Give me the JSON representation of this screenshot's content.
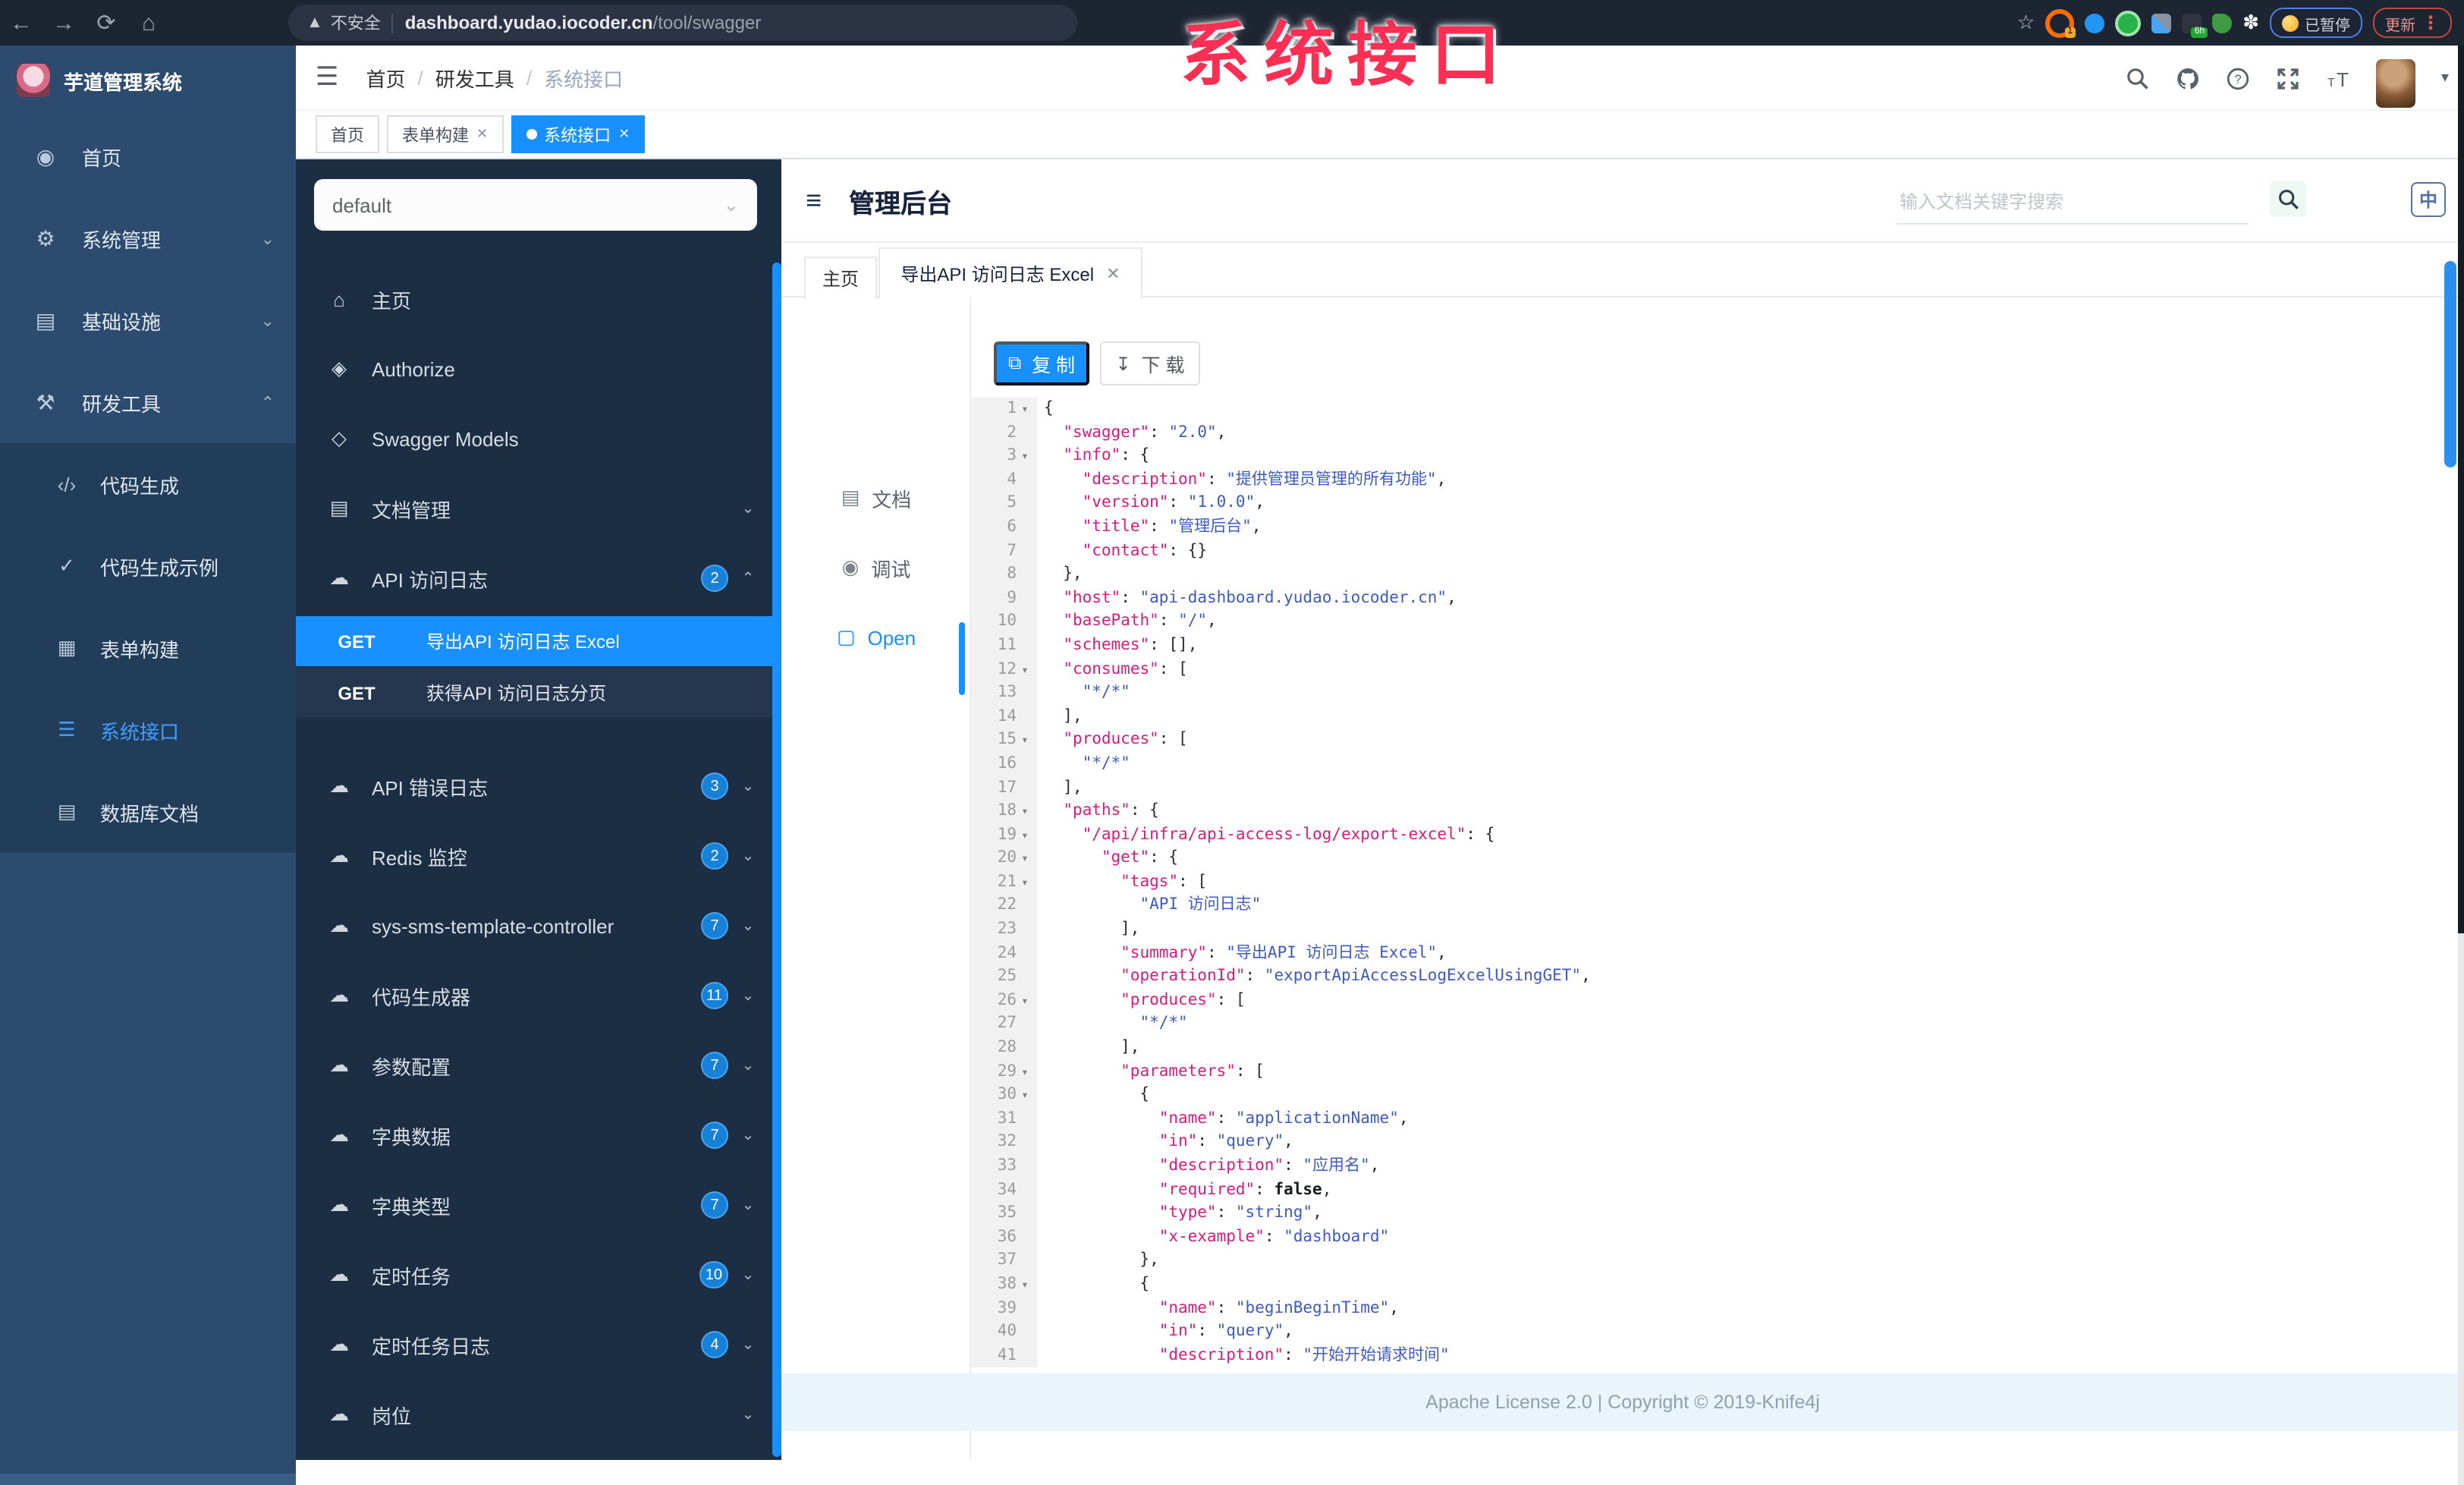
{
  "overlay": {
    "text": "系统接口",
    "color": "#fb2e53"
  },
  "browser": {
    "security_label": "不安全",
    "url_host": "dashboard.yudao.iocoder.cn",
    "url_path": "/tool/swagger",
    "ext_badge_orange": "1",
    "ext_badge_time": "6h",
    "paused_label": "已暂停",
    "update_label": "更新"
  },
  "app": {
    "logo_title": "芋道管理系统",
    "breadcrumb": [
      "首页",
      "研发工具",
      "系统接口"
    ],
    "tags": [
      {
        "label": "首页",
        "active": false,
        "closable": false
      },
      {
        "label": "表单构建",
        "active": false,
        "closable": true
      },
      {
        "label": "系统接口",
        "active": true,
        "closable": true
      }
    ],
    "sidebar_items": [
      {
        "icon": "gauge-icon",
        "label": "首页",
        "chevron": ""
      },
      {
        "icon": "gear-icon",
        "label": "系统管理",
        "chevron": "down"
      },
      {
        "icon": "monitor-icon",
        "label": "基础设施",
        "chevron": "down"
      },
      {
        "icon": "toolbox-icon",
        "label": "研发工具",
        "chevron": "up"
      }
    ],
    "sidebar_submenu": [
      {
        "icon": "code-icon",
        "label": "代码生成",
        "active": false
      },
      {
        "icon": "shield-check-icon",
        "label": "代码生成示例",
        "active": false
      },
      {
        "icon": "grid-icon",
        "label": "表单构建",
        "active": false
      },
      {
        "icon": "list-icon",
        "label": "系统接口",
        "active": true
      },
      {
        "icon": "table-icon",
        "label": "数据库文档",
        "active": false
      }
    ]
  },
  "kpanel": {
    "group_value": "default",
    "menu": [
      {
        "icon": "home-icon",
        "label": "主页",
        "badge": "",
        "chevron": ""
      },
      {
        "icon": "lock-icon",
        "label": "Authorize",
        "badge": "",
        "chevron": ""
      },
      {
        "icon": "models-icon",
        "label": "Swagger Models",
        "badge": "",
        "chevron": ""
      },
      {
        "icon": "doc-icon",
        "label": "文档管理",
        "badge": "",
        "chevron": "down"
      },
      {
        "icon": "cloud-icon",
        "label": "API 访问日志",
        "badge": "2",
        "chevron": "up",
        "children": [
          {
            "method": "GET",
            "name": "导出API 访问日志 Excel",
            "active": true
          },
          {
            "method": "GET",
            "name": "获得API 访问日志分页",
            "active": false
          }
        ]
      },
      {
        "icon": "cloud-icon",
        "label": "API 错误日志",
        "badge": "3",
        "chevron": "down"
      },
      {
        "icon": "cloud-icon",
        "label": "Redis 监控",
        "badge": "2",
        "chevron": "down"
      },
      {
        "icon": "cloud-icon",
        "label": "sys-sms-template-controller",
        "badge": "7",
        "chevron": "down"
      },
      {
        "icon": "cloud-icon",
        "label": "代码生成器",
        "badge": "11",
        "chevron": "down"
      },
      {
        "icon": "cloud-icon",
        "label": "参数配置",
        "badge": "7",
        "chevron": "down"
      },
      {
        "icon": "cloud-icon",
        "label": "字典数据",
        "badge": "7",
        "chevron": "down"
      },
      {
        "icon": "cloud-icon",
        "label": "字典类型",
        "badge": "7",
        "chevron": "down"
      },
      {
        "icon": "cloud-icon",
        "label": "定时任务",
        "badge": "10",
        "chevron": "down"
      },
      {
        "icon": "cloud-icon",
        "label": "定时任务日志",
        "badge": "4",
        "chevron": "down"
      },
      {
        "icon": "cloud-icon",
        "label": "岗位",
        "badge": "",
        "chevron": "down"
      }
    ]
  },
  "doc": {
    "title": "管理后台",
    "search_placeholder": "输入文档关键字搜索",
    "lang_label": "中",
    "tabs": [
      {
        "label": "主页",
        "closable": false,
        "active": false
      },
      {
        "label": "导出API 访问日志 Excel",
        "closable": true,
        "active": true
      }
    ],
    "side_tabs": [
      {
        "icon": "document-icon",
        "label": "文档",
        "active": false
      },
      {
        "icon": "bug-icon",
        "label": "调试",
        "active": false
      },
      {
        "icon": "file-icon",
        "label": "Open",
        "active": true
      }
    ],
    "copy_label": "复 制",
    "download_label": "下 载",
    "footer": "Apache License 2.0 | Copyright © 2019-Knife4j"
  },
  "code": {
    "lines": [
      {
        "n": 1,
        "f": true,
        "s": [
          [
            "pun",
            "{"
          ]
        ]
      },
      {
        "n": 2,
        "f": false,
        "s": [
          [
            "pun",
            "  "
          ],
          [
            "key",
            "\"swagger\""
          ],
          [
            "pun",
            ": "
          ],
          [
            "str",
            "\"2.0\""
          ],
          [
            "pun",
            ","
          ]
        ]
      },
      {
        "n": 3,
        "f": true,
        "s": [
          [
            "pun",
            "  "
          ],
          [
            "key",
            "\"info\""
          ],
          [
            "pun",
            ": {"
          ]
        ]
      },
      {
        "n": 4,
        "f": false,
        "s": [
          [
            "pun",
            "    "
          ],
          [
            "key",
            "\"description\""
          ],
          [
            "pun",
            ": "
          ],
          [
            "str",
            "\"提供管理员管理的所有功能\""
          ],
          [
            "pun",
            ","
          ]
        ]
      },
      {
        "n": 5,
        "f": false,
        "s": [
          [
            "pun",
            "    "
          ],
          [
            "key",
            "\"version\""
          ],
          [
            "pun",
            ": "
          ],
          [
            "str",
            "\"1.0.0\""
          ],
          [
            "pun",
            ","
          ]
        ]
      },
      {
        "n": 6,
        "f": false,
        "s": [
          [
            "pun",
            "    "
          ],
          [
            "key",
            "\"title\""
          ],
          [
            "pun",
            ": "
          ],
          [
            "str",
            "\"管理后台\""
          ],
          [
            "pun",
            ","
          ]
        ]
      },
      {
        "n": 7,
        "f": false,
        "s": [
          [
            "pun",
            "    "
          ],
          [
            "key",
            "\"contact\""
          ],
          [
            "pun",
            ": {}"
          ]
        ]
      },
      {
        "n": 8,
        "f": false,
        "s": [
          [
            "pun",
            "  },"
          ]
        ]
      },
      {
        "n": 9,
        "f": false,
        "s": [
          [
            "pun",
            "  "
          ],
          [
            "key",
            "\"host\""
          ],
          [
            "pun",
            ": "
          ],
          [
            "str",
            "\"api-dashboard.yudao.iocoder.cn\""
          ],
          [
            "pun",
            ","
          ]
        ]
      },
      {
        "n": 10,
        "f": false,
        "s": [
          [
            "pun",
            "  "
          ],
          [
            "key",
            "\"basePath\""
          ],
          [
            "pun",
            ": "
          ],
          [
            "str",
            "\"/\""
          ],
          [
            "pun",
            ","
          ]
        ]
      },
      {
        "n": 11,
        "f": false,
        "s": [
          [
            "pun",
            "  "
          ],
          [
            "key",
            "\"schemes\""
          ],
          [
            "pun",
            ": [],"
          ]
        ]
      },
      {
        "n": 12,
        "f": true,
        "s": [
          [
            "pun",
            "  "
          ],
          [
            "key",
            "\"consumes\""
          ],
          [
            "pun",
            ": ["
          ]
        ]
      },
      {
        "n": 13,
        "f": false,
        "s": [
          [
            "pun",
            "    "
          ],
          [
            "str",
            "\"*/*\""
          ]
        ]
      },
      {
        "n": 14,
        "f": false,
        "s": [
          [
            "pun",
            "  ],"
          ]
        ]
      },
      {
        "n": 15,
        "f": true,
        "s": [
          [
            "pun",
            "  "
          ],
          [
            "key",
            "\"produces\""
          ],
          [
            "pun",
            ": ["
          ]
        ]
      },
      {
        "n": 16,
        "f": false,
        "s": [
          [
            "pun",
            "    "
          ],
          [
            "str",
            "\"*/*\""
          ]
        ]
      },
      {
        "n": 17,
        "f": false,
        "s": [
          [
            "pun",
            "  ],"
          ]
        ]
      },
      {
        "n": 18,
        "f": true,
        "s": [
          [
            "pun",
            "  "
          ],
          [
            "key",
            "\"paths\""
          ],
          [
            "pun",
            ": {"
          ]
        ]
      },
      {
        "n": 19,
        "f": true,
        "s": [
          [
            "pun",
            "    "
          ],
          [
            "key",
            "\"/api/infra/api-access-log/export-excel\""
          ],
          [
            "pun",
            ": {"
          ]
        ]
      },
      {
        "n": 20,
        "f": true,
        "s": [
          [
            "pun",
            "      "
          ],
          [
            "key",
            "\"get\""
          ],
          [
            "pun",
            ": {"
          ]
        ]
      },
      {
        "n": 21,
        "f": true,
        "s": [
          [
            "pun",
            "        "
          ],
          [
            "key",
            "\"tags\""
          ],
          [
            "pun",
            ": ["
          ]
        ]
      },
      {
        "n": 22,
        "f": false,
        "s": [
          [
            "pun",
            "          "
          ],
          [
            "str",
            "\"API 访问日志\""
          ]
        ]
      },
      {
        "n": 23,
        "f": false,
        "s": [
          [
            "pun",
            "        ],"
          ]
        ]
      },
      {
        "n": 24,
        "f": false,
        "s": [
          [
            "pun",
            "        "
          ],
          [
            "key",
            "\"summary\""
          ],
          [
            "pun",
            ": "
          ],
          [
            "str",
            "\"导出API 访问日志 Excel\""
          ],
          [
            "pun",
            ","
          ]
        ]
      },
      {
        "n": 25,
        "f": false,
        "s": [
          [
            "pun",
            "        "
          ],
          [
            "key",
            "\"operationId\""
          ],
          [
            "pun",
            ": "
          ],
          [
            "str",
            "\"exportApiAccessLogExcelUsingGET\""
          ],
          [
            "pun",
            ","
          ]
        ]
      },
      {
        "n": 26,
        "f": true,
        "s": [
          [
            "pun",
            "        "
          ],
          [
            "key",
            "\"produces\""
          ],
          [
            "pun",
            ": ["
          ]
        ]
      },
      {
        "n": 27,
        "f": false,
        "s": [
          [
            "pun",
            "          "
          ],
          [
            "str",
            "\"*/*\""
          ]
        ]
      },
      {
        "n": 28,
        "f": false,
        "s": [
          [
            "pun",
            "        ],"
          ]
        ]
      },
      {
        "n": 29,
        "f": true,
        "s": [
          [
            "pun",
            "        "
          ],
          [
            "key",
            "\"parameters\""
          ],
          [
            "pun",
            ": ["
          ]
        ]
      },
      {
        "n": 30,
        "f": true,
        "s": [
          [
            "pun",
            "          {"
          ]
        ]
      },
      {
        "n": 31,
        "f": false,
        "s": [
          [
            "pun",
            "            "
          ],
          [
            "key",
            "\"name\""
          ],
          [
            "pun",
            ": "
          ],
          [
            "str",
            "\"applicationName\""
          ],
          [
            "pun",
            ","
          ]
        ]
      },
      {
        "n": 32,
        "f": false,
        "s": [
          [
            "pun",
            "            "
          ],
          [
            "key",
            "\"in\""
          ],
          [
            "pun",
            ": "
          ],
          [
            "str",
            "\"query\""
          ],
          [
            "pun",
            ","
          ]
        ]
      },
      {
        "n": 33,
        "f": false,
        "s": [
          [
            "pun",
            "            "
          ],
          [
            "key",
            "\"description\""
          ],
          [
            "pun",
            ": "
          ],
          [
            "str",
            "\"应用名\""
          ],
          [
            "pun",
            ","
          ]
        ]
      },
      {
        "n": 34,
        "f": false,
        "s": [
          [
            "pun",
            "            "
          ],
          [
            "key",
            "\"required\""
          ],
          [
            "pun",
            ": "
          ],
          [
            "boo",
            "false"
          ],
          [
            "pun",
            ","
          ]
        ]
      },
      {
        "n": 35,
        "f": false,
        "s": [
          [
            "pun",
            "            "
          ],
          [
            "key",
            "\"type\""
          ],
          [
            "pun",
            ": "
          ],
          [
            "str",
            "\"string\""
          ],
          [
            "pun",
            ","
          ]
        ]
      },
      {
        "n": 36,
        "f": false,
        "s": [
          [
            "pun",
            "            "
          ],
          [
            "key",
            "\"x-example\""
          ],
          [
            "pun",
            ": "
          ],
          [
            "str",
            "\"dashboard\""
          ]
        ]
      },
      {
        "n": 37,
        "f": false,
        "s": [
          [
            "pun",
            "          },"
          ]
        ]
      },
      {
        "n": 38,
        "f": true,
        "s": [
          [
            "pun",
            "          {"
          ]
        ]
      },
      {
        "n": 39,
        "f": false,
        "s": [
          [
            "pun",
            "            "
          ],
          [
            "key",
            "\"name\""
          ],
          [
            "pun",
            ": "
          ],
          [
            "str",
            "\"beginBeginTime\""
          ],
          [
            "pun",
            ","
          ]
        ]
      },
      {
        "n": 40,
        "f": false,
        "s": [
          [
            "pun",
            "            "
          ],
          [
            "key",
            "\"in\""
          ],
          [
            "pun",
            ": "
          ],
          [
            "str",
            "\"query\""
          ],
          [
            "pun",
            ","
          ]
        ]
      },
      {
        "n": 41,
        "f": false,
        "s": [
          [
            "pun",
            "            "
          ],
          [
            "key",
            "\"description\""
          ],
          [
            "pun",
            ": "
          ],
          [
            "str",
            "\"开始开始请求时间\""
          ]
        ]
      }
    ]
  }
}
